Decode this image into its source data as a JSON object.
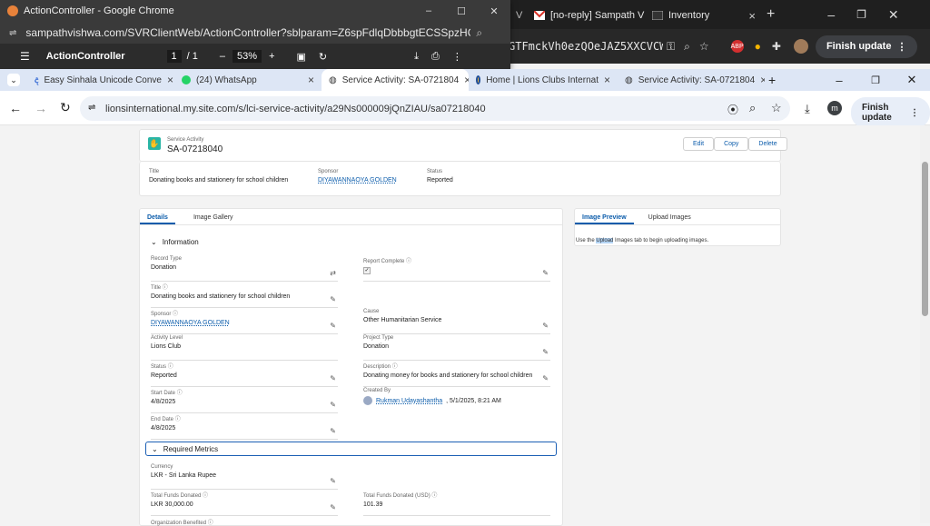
{
  "background_window": {
    "tabs": [
      {
        "icon": "gmail-icon",
        "label": "[no-reply] Sampath V"
      },
      {
        "icon": "inventory-icon",
        "label": "Inventory"
      }
    ],
    "omnibox_text": "GTFmckVh0ezQOeJAZ5XXCVCW...",
    "finish_update": "Finish update"
  },
  "popup": {
    "title": "ActionController - Google Chrome",
    "url": "sampathvishwa.com/SVRClientWeb/ActionController?sblparam=Z6spFdlqDbbbgtECSSpzHGTWhM4dmn...",
    "pdf_title": "ActionController",
    "page_current": "1",
    "page_total": "/ 1",
    "zoom": "53%"
  },
  "tabs": [
    {
      "icon": "sinhala-icon",
      "label": "Easy Sinhala Unicode Conve"
    },
    {
      "icon": "whatsapp-icon",
      "label": "(24) WhatsApp"
    },
    {
      "icon": "globe-icon",
      "label": "Service Activity: SA-0721804"
    },
    {
      "icon": "lions-icon",
      "label": "Home | Lions Clubs Internat"
    },
    {
      "icon": "globe-icon",
      "label": "Service Activity: SA-0721804"
    }
  ],
  "url": "lionsinternational.my.site.com/s/lci-service-activity/a29Ns000009jQnZIAU/sa07218040",
  "finish_update": "Finish update",
  "avatar_letter": "m",
  "record": {
    "type_label": "Service Activity",
    "id": "SA-07218040",
    "buttons": {
      "edit": "Edit",
      "copy": "Copy",
      "delete": "Delete"
    },
    "highlights": {
      "title_label": "Title",
      "title_value": "Donating books and stationery for school children",
      "sponsor_label": "Sponsor",
      "sponsor_value": "DIYAWANNAOYA GOLDEN",
      "status_label": "Status",
      "status_value": "Reported"
    }
  },
  "left_tabs": {
    "details": "Details",
    "gallery": "Image Gallery"
  },
  "information": {
    "header": "Information",
    "record_type_label": "Record Type",
    "record_type": "Donation",
    "report_complete_label": "Report Complete",
    "title_label": "Title",
    "title": "Donating books and stationery for school children",
    "sponsor_label": "Sponsor",
    "sponsor": "DIYAWANNAOYA GOLDEN",
    "cause_label": "Cause",
    "cause": "Other Humanitarian Service",
    "activity_level_label": "Activity Level",
    "activity_level": "Lions Club",
    "project_type_label": "Project Type",
    "project_type": "Donation",
    "status_label": "Status",
    "status": "Reported",
    "description_label": "Description",
    "description": "Donating money for books and stationery for school children",
    "start_date_label": "Start Date",
    "start_date": "4/8/2025",
    "created_by_label": "Created By",
    "created_by_name": "Rukman Udayashantha",
    "created_by_date": ", 5/1/2025, 8:21 AM",
    "end_date_label": "End Date",
    "end_date": "4/8/2025"
  },
  "metrics": {
    "header": "Required Metrics",
    "currency_label": "Currency",
    "currency": "LKR - Sri Lanka Rupee",
    "funds_label": "Total Funds Donated",
    "funds": "LKR 30,000.00",
    "funds_usd_label": "Total Funds Donated (USD)",
    "funds_usd": "101.39",
    "org_label": "Organization Benefited"
  },
  "right_tabs": {
    "preview": "Image Preview",
    "upload": "Upload Images"
  },
  "right_text": {
    "pre": "Use the ",
    "highlight": "Upload",
    "mid": " Images",
    "post": " tab to begin uploading images."
  }
}
